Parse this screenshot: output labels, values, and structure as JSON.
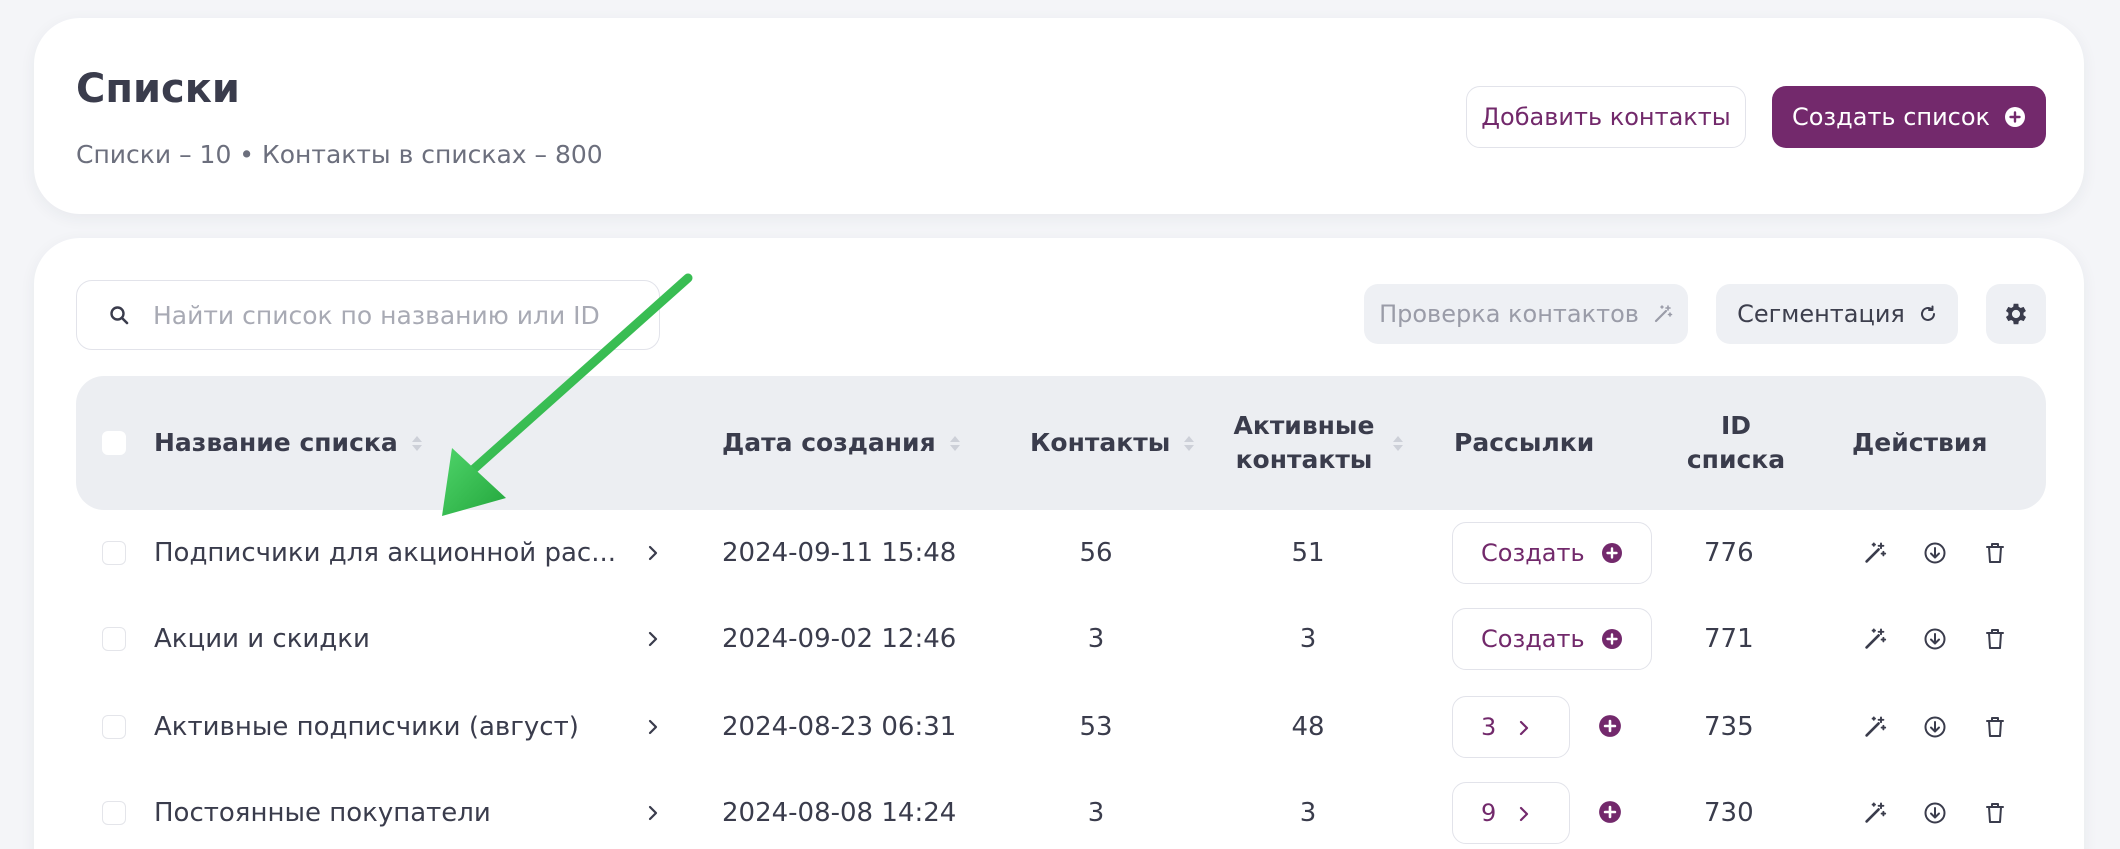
{
  "header": {
    "title": "Списки",
    "stats": "Списки – 10 • Контакты в списках – 800",
    "add_contacts_label": "Добавить контакты",
    "create_list_label": "Создать список"
  },
  "toolbar": {
    "search_placeholder": "Найти список по названию или ID",
    "check_contacts_label": "Проверка контактов",
    "segmentation_label": "Сегментация",
    "settings_icon": "gear-icon"
  },
  "table": {
    "columns": {
      "name": "Название списка",
      "date": "Дата создания",
      "contacts": "Контакты",
      "active": "Активные контакты",
      "mailings": "Рассылки",
      "id": "ID списка",
      "actions": "Действия"
    },
    "rows": [
      {
        "name": "Подписчики для акционной рас...",
        "date": "2024-09-11 15:48",
        "contacts": "56",
        "active": "51",
        "mailings": "Создать",
        "id": "776"
      },
      {
        "name": "Акции и скидки",
        "date": "2024-09-02 12:46",
        "contacts": "3",
        "active": "3",
        "mailings": "Создать",
        "id": "771"
      },
      {
        "name": "Активные подписчики (август)",
        "date": "2024-08-23 06:31",
        "contacts": "53",
        "active": "48",
        "mailings": "3",
        "id": "735"
      },
      {
        "name": "Постоянные покупатели",
        "date": "2024-08-08 14:24",
        "contacts": "3",
        "active": "3",
        "mailings": "9",
        "id": "730"
      }
    ]
  },
  "colors": {
    "accent": "#73296c",
    "annotation_arrow": "#2fb84a"
  }
}
